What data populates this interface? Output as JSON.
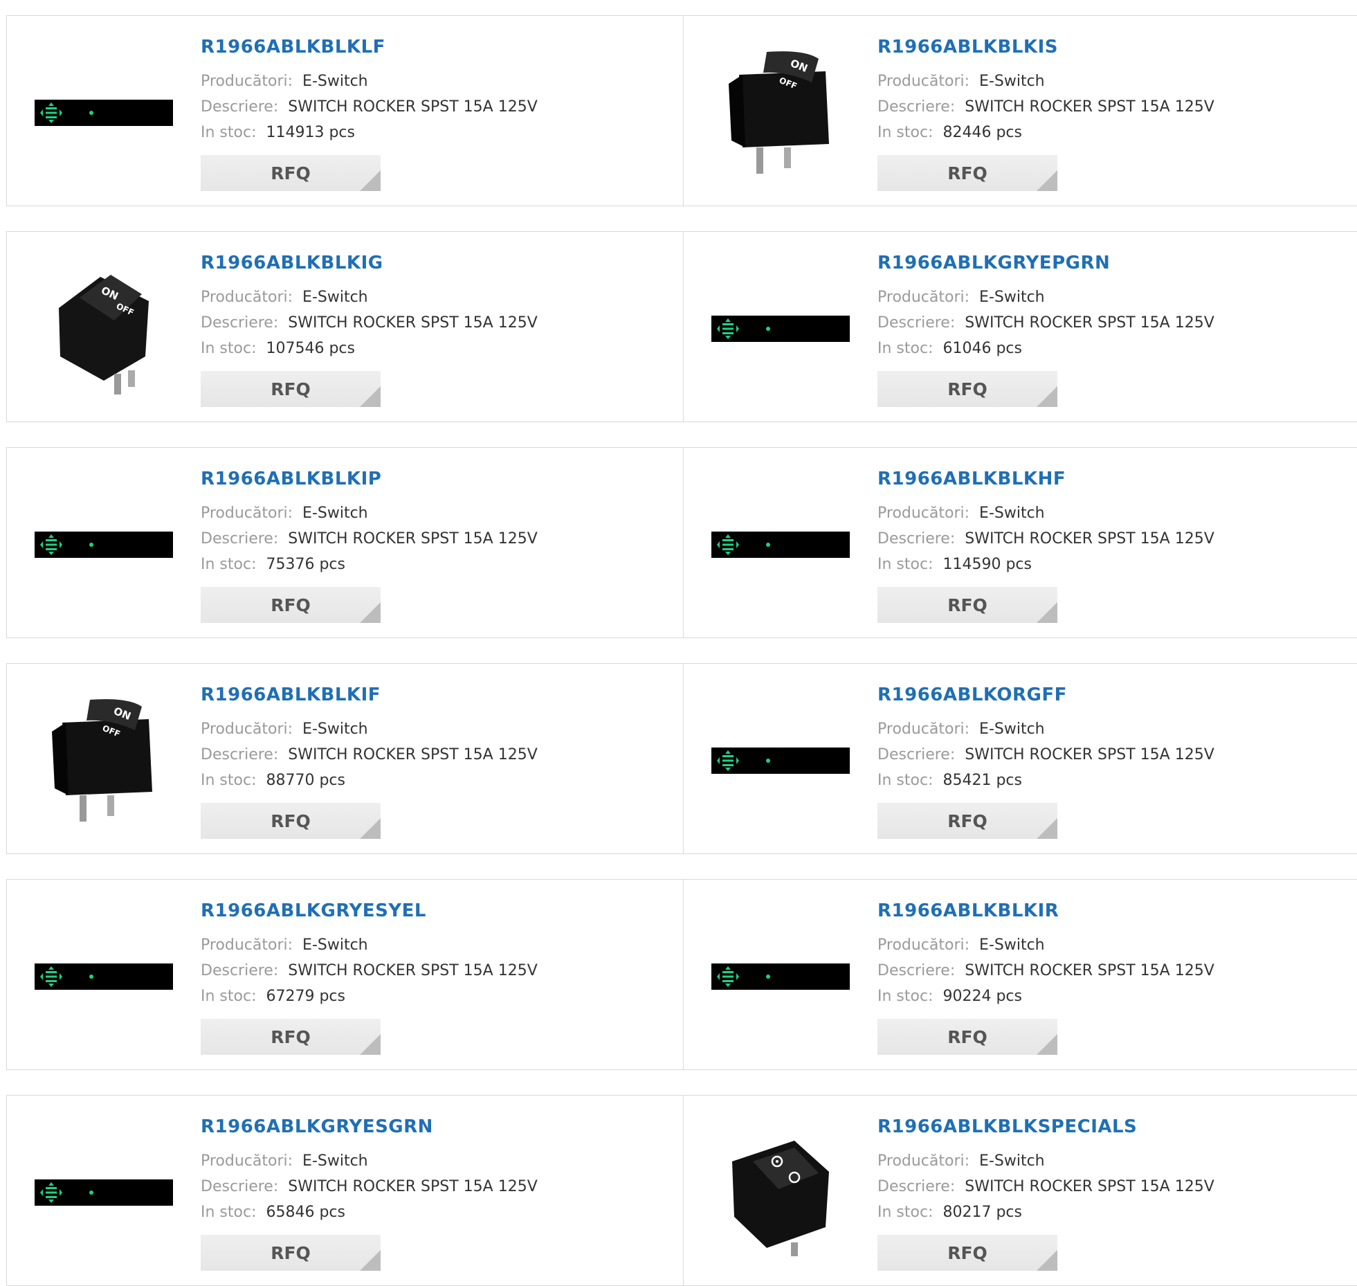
{
  "labels": {
    "manufacturer": "Producători:",
    "description": "Descriere:",
    "stock": "In stoc:",
    "rfq": "RFQ"
  },
  "colors": {
    "link": "#1f6fb5",
    "label": "#9a9a9a",
    "value": "#333333",
    "rfq_bg": "#e9e9e9",
    "placeholder": "#000000",
    "placeholder_glyph": "#19d38a"
  },
  "products": [
    {
      "part": "R1966ABLKBLKLF",
      "manufacturer": "E-Switch",
      "description": "SWITCH ROCKER SPST 15A 125V",
      "stock": "114913 pcs",
      "image": "placeholder"
    },
    {
      "part": "R1966ABLKBLKIS",
      "manufacturer": "E-Switch",
      "description": "SWITCH ROCKER SPST 15A 125V",
      "stock": "82446 pcs",
      "image": "rocker-tall"
    },
    {
      "part": "R1966ABLKBLKIG",
      "manufacturer": "E-Switch",
      "description": "SWITCH ROCKER SPST 15A 125V",
      "stock": "107546 pcs",
      "image": "rocker-angled"
    },
    {
      "part": "R1966ABLKGRYEPGRN",
      "manufacturer": "E-Switch",
      "description": "SWITCH ROCKER SPST 15A 125V",
      "stock": "61046 pcs",
      "image": "placeholder"
    },
    {
      "part": "R1966ABLKBLKIP",
      "manufacturer": "E-Switch",
      "description": "SWITCH ROCKER SPST 15A 125V",
      "stock": "75376 pcs",
      "image": "placeholder"
    },
    {
      "part": "R1966ABLKBLKHF",
      "manufacturer": "E-Switch",
      "description": "SWITCH ROCKER SPST 15A 125V",
      "stock": "114590 pcs",
      "image": "placeholder"
    },
    {
      "part": "R1966ABLKBLKIF",
      "manufacturer": "E-Switch",
      "description": "SWITCH ROCKER SPST 15A 125V",
      "stock": "88770 pcs",
      "image": "rocker-tall"
    },
    {
      "part": "R1966ABLKORGFF",
      "manufacturer": "E-Switch",
      "description": "SWITCH ROCKER SPST 15A 125V",
      "stock": "85421 pcs",
      "image": "placeholder"
    },
    {
      "part": "R1966ABLKGRYESYEL",
      "manufacturer": "E-Switch",
      "description": "SWITCH ROCKER SPST 15A 125V",
      "stock": "67279 pcs",
      "image": "placeholder"
    },
    {
      "part": "R1966ABLKBLKIR",
      "manufacturer": "E-Switch",
      "description": "SWITCH ROCKER SPST 15A 125V",
      "stock": "90224 pcs",
      "image": "placeholder"
    },
    {
      "part": "R1966ABLKGRYESGRN",
      "manufacturer": "E-Switch",
      "description": "SWITCH ROCKER SPST 15A 125V",
      "stock": "65846 pcs",
      "image": "placeholder"
    },
    {
      "part": "R1966ABLKBLKSPECIALS",
      "manufacturer": "E-Switch",
      "description": "SWITCH ROCKER SPST 15A 125V",
      "stock": "80217 pcs",
      "image": "rocker-symbol"
    }
  ]
}
